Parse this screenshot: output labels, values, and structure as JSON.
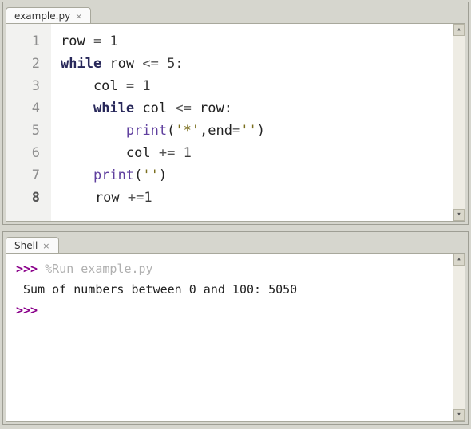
{
  "editor": {
    "tab_label": "example.py",
    "current_line": 8,
    "lines": [
      {
        "n": 1,
        "tokens": [
          {
            "t": "row ",
            "c": ""
          },
          {
            "t": "=",
            "c": "op"
          },
          {
            "t": " "
          },
          {
            "t": "1",
            "c": "num"
          }
        ]
      },
      {
        "n": 2,
        "tokens": [
          {
            "t": "while",
            "c": "kw"
          },
          {
            "t": " row "
          },
          {
            "t": "<=",
            "c": "op"
          },
          {
            "t": " "
          },
          {
            "t": "5",
            "c": "num"
          },
          {
            "t": ":"
          }
        ]
      },
      {
        "n": 3,
        "tokens": [
          {
            "t": "    col "
          },
          {
            "t": "=",
            "c": "op"
          },
          {
            "t": " "
          },
          {
            "t": "1",
            "c": "num"
          }
        ]
      },
      {
        "n": 4,
        "tokens": [
          {
            "t": "    "
          },
          {
            "t": "while",
            "c": "kw"
          },
          {
            "t": " col "
          },
          {
            "t": "<=",
            "c": "op"
          },
          {
            "t": " row:"
          }
        ]
      },
      {
        "n": 5,
        "tokens": [
          {
            "t": "        "
          },
          {
            "t": "print",
            "c": "fn"
          },
          {
            "t": "("
          },
          {
            "t": "'*'",
            "c": "str"
          },
          {
            "t": ",end"
          },
          {
            "t": "=",
            "c": "op"
          },
          {
            "t": "''",
            "c": "str"
          },
          {
            "t": ")"
          }
        ]
      },
      {
        "n": 6,
        "tokens": [
          {
            "t": "        col "
          },
          {
            "t": "+=",
            "c": "op"
          },
          {
            "t": " "
          },
          {
            "t": "1",
            "c": "num"
          }
        ]
      },
      {
        "n": 7,
        "tokens": [
          {
            "t": "    "
          },
          {
            "t": "print",
            "c": "fn"
          },
          {
            "t": "("
          },
          {
            "t": "''",
            "c": "str"
          },
          {
            "t": ")"
          }
        ]
      },
      {
        "n": 8,
        "tokens": [
          {
            "t": "    row "
          },
          {
            "t": "+=",
            "c": "op"
          },
          {
            "t": "1",
            "c": "num"
          }
        ],
        "cursor_before": true
      }
    ]
  },
  "shell": {
    "tab_label": "Shell",
    "lines": [
      {
        "segments": [
          {
            "t": ">>> ",
            "c": "prompt"
          },
          {
            "t": "%Run example.py",
            "c": "runcmd"
          }
        ]
      },
      {
        "segments": [
          {
            "t": " Sum of numbers between 0 and 100: 5050",
            "c": ""
          }
        ]
      },
      {
        "segments": [
          {
            "t": ">>> ",
            "c": "prompt"
          }
        ]
      }
    ]
  },
  "icons": {
    "close": "×",
    "up": "▴",
    "down": "▾"
  }
}
